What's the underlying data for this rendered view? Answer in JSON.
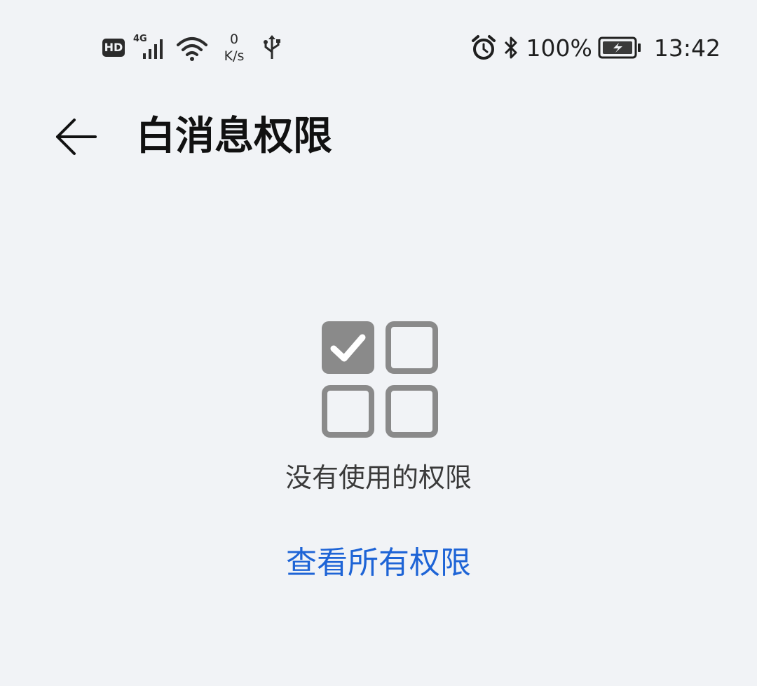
{
  "status_bar": {
    "hd_badge": "HD",
    "network_type": "4G",
    "net_speed_value": "0",
    "net_speed_unit": "K/s",
    "battery_percent": "100%",
    "time": "13:42",
    "icons": [
      "hd-icon",
      "signal-icon",
      "wifi-icon",
      "usb-icon",
      "alarm-icon",
      "bluetooth-icon",
      "battery-charging-icon"
    ]
  },
  "header": {
    "back_icon": "arrow-left-icon",
    "title": "白消息权限"
  },
  "empty_state": {
    "icon": "permission-grid-icon",
    "message": "没有使用的权限",
    "link_label": "查看所有权限"
  },
  "colors": {
    "background": "#f1f3f6",
    "accent": "#1e64d6",
    "icon_gray": "#8a8a8a"
  }
}
